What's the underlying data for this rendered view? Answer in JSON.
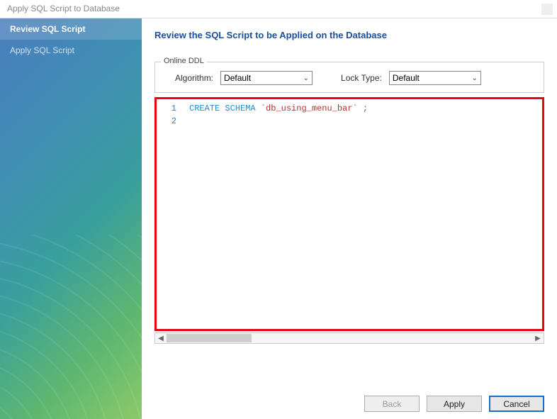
{
  "window": {
    "title": "Apply SQL Script to Database"
  },
  "sidebar": {
    "steps": [
      {
        "label": "Review SQL Script",
        "active": true
      },
      {
        "label": "Apply SQL Script",
        "active": false
      }
    ]
  },
  "main": {
    "heading": "Review the SQL Script to be Applied on the Database",
    "ddl": {
      "legend": "Online DDL",
      "algorithm_label": "Algorithm:",
      "algorithm_value": "Default",
      "locktype_label": "Lock Type:",
      "locktype_value": "Default"
    },
    "editor": {
      "lines": [
        "1",
        "2"
      ],
      "sql_keyword": "CREATE SCHEMA",
      "sql_identifier": "`db_using_menu_bar`",
      "sql_terminator": " ;"
    }
  },
  "buttons": {
    "back": "Back",
    "apply": "Apply",
    "cancel": "Cancel"
  }
}
